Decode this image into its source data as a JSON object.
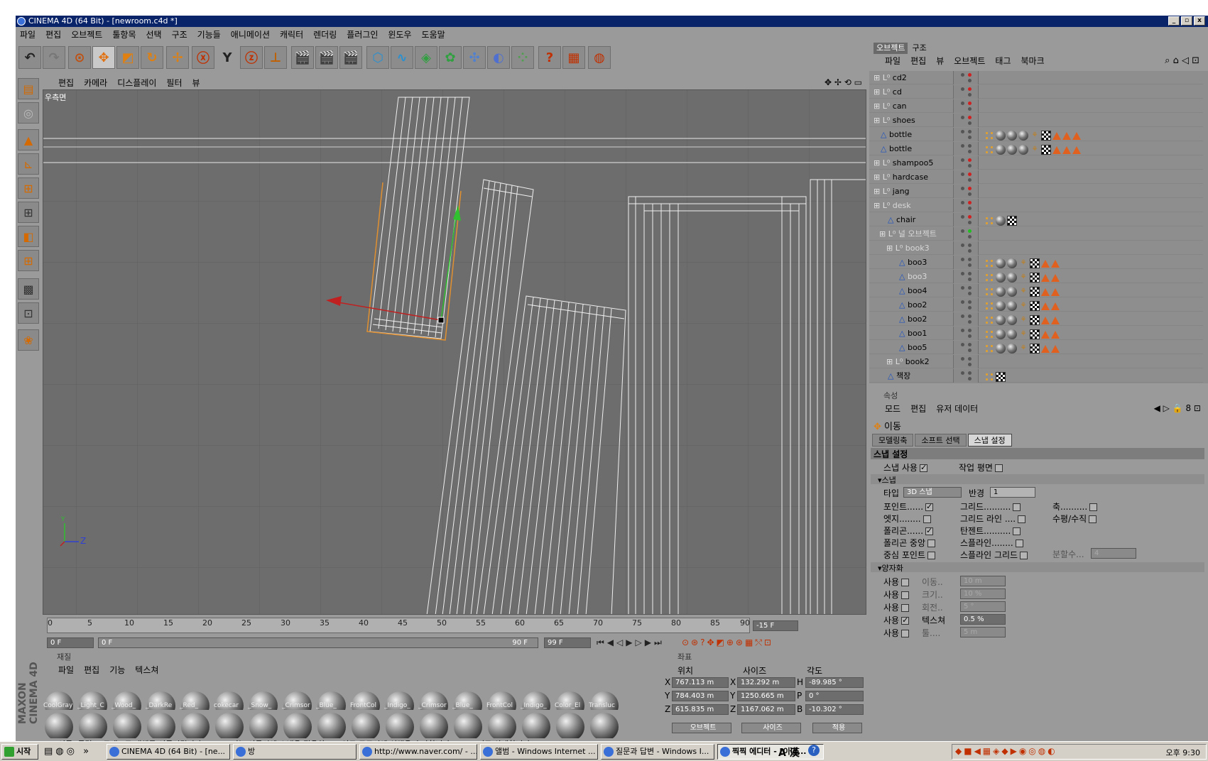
{
  "window": {
    "title": "CINEMA 4D (64 Bit) - [newroom.c4d *]"
  },
  "menu": [
    "파일",
    "편집",
    "오브젝트",
    "툴항목",
    "선택",
    "구조",
    "기능들",
    "애니메이션",
    "캐릭터",
    "렌더링",
    "플러그인",
    "윈도우",
    "도움말"
  ],
  "toolbar": {
    "y_label": "Y",
    "x_label": "X",
    "z_label": "Z"
  },
  "viewport": {
    "menu": [
      "편집",
      "카메라",
      "디스플레이",
      "필터",
      "뷰"
    ],
    "label": "우측면",
    "axis_z": "Z",
    "axis_y": "Y"
  },
  "timeline": {
    "ticks": [
      "0",
      "5",
      "10",
      "15",
      "20",
      "25",
      "30",
      "35",
      "40",
      "45",
      "50",
      "55",
      "60",
      "65",
      "70",
      "75",
      "80",
      "85",
      "90"
    ],
    "end_field": "-15 F",
    "current_frame": "0 F",
    "range_start": "0 F",
    "range_end": "90 F",
    "max_frame": "99 F"
  },
  "materials": {
    "header": "재질",
    "menu": [
      "파일",
      "편집",
      "기능",
      "텍스쳐"
    ],
    "row1": [
      "CoolGray",
      "_Light_C",
      "_Wood_",
      "_DarkRe",
      "_Red_",
      "cokecar",
      "_Snow_",
      "_Crimsor",
      "_Blue_",
      "FrontCol",
      "_Indigo_",
      "_Crimsor",
      "_Blue_",
      "FrontCol",
      "_Indigo_",
      "Color_El",
      "Transluc"
    ],
    "row2_count": 17
  },
  "coords": {
    "header": "좌표",
    "col_position": "위치",
    "col_size": "사이즈",
    "col_angle": "각도",
    "rows": [
      {
        "axis": "X",
        "pos": "767.113 m",
        "size_axis": "X",
        "size": "132.292 m",
        "ang_axis": "H",
        "ang": "-89.985 °"
      },
      {
        "axis": "Y",
        "pos": "784.403 m",
        "size_axis": "Y",
        "size": "1250.665 m",
        "ang_axis": "P",
        "ang": "0 °"
      },
      {
        "axis": "Z",
        "pos": "615.835 m",
        "size_axis": "Z",
        "size": "1167.062 m",
        "ang_axis": "B",
        "ang": "-10.302 °"
      }
    ],
    "mode_select": "오브젝트",
    "size_select": "사이즈",
    "apply_button": "적용"
  },
  "status": "이동: 클릭 & 드래그로 개체를 이동시킵니다. SHIFT 키는 이동시엔 스냅을 적용하고 포인트 모드시엔 선택을 추가합니다. CTRL 키로 삭제합니다.",
  "objects_panel": {
    "tabs": [
      "오브젝트",
      "구조"
    ],
    "menu": [
      "파일",
      "편집",
      "뷰",
      "오브젝트",
      "태그",
      "북마크"
    ],
    "rows": [
      {
        "name": "cd2",
        "tags": ""
      },
      {
        "name": "cd",
        "tags": ""
      },
      {
        "name": "can",
        "tags": ""
      },
      {
        "name": "shoes",
        "tags": ""
      },
      {
        "name": "bottle",
        "tags": "full"
      },
      {
        "name": "bottle",
        "tags": "full"
      },
      {
        "name": "shampoo5",
        "tags": ""
      },
      {
        "name": "hardcase",
        "tags": ""
      },
      {
        "name": "jang",
        "tags": ""
      },
      {
        "name": "desk",
        "tags": ""
      },
      {
        "name": "chair",
        "tags": "short"
      },
      {
        "name": "널 오브젝트",
        "tags": ""
      },
      {
        "name": "book3",
        "tags": ""
      },
      {
        "name": "boo3",
        "tags": "book"
      },
      {
        "name": "boo3",
        "tags": "book"
      },
      {
        "name": "boo4",
        "tags": "book"
      },
      {
        "name": "boo2",
        "tags": "book"
      },
      {
        "name": "boo2",
        "tags": "book"
      },
      {
        "name": "boo1",
        "tags": "book"
      },
      {
        "name": "boo5",
        "tags": "book"
      },
      {
        "name": "book2",
        "tags": ""
      },
      {
        "name": "책장",
        "tags": "mini"
      }
    ]
  },
  "attributes": {
    "header": "속성",
    "menu": [
      "모드",
      "편집",
      "유저 데이터"
    ],
    "tool_name": "이동",
    "tabs": [
      "모델링축",
      "소프트 선택",
      "스냅 설정"
    ],
    "section_title": "스냅 설정",
    "snap_use": "스냅 사용",
    "work_plane": "작업 평면",
    "snap_group": "스냅",
    "type_label": "타입",
    "type_value": "3D 스냅",
    "radius_label": "반경",
    "radius_value": "1",
    "col1": [
      "포인트......",
      "엣지........",
      "폴리곤......",
      "폴리곤 중앙",
      "중심 포인트"
    ],
    "col2": [
      "그리드..........",
      "그리드 라인 ....",
      "탄젠트..........",
      "스플라인........",
      "스플라인 그리드"
    ],
    "col3": [
      "축..........",
      "수평/수직"
    ],
    "subdiv_label": "분할수...",
    "subdiv_value": "4",
    "quant_group": "양자화",
    "quant_rows": [
      {
        "use": "사용",
        "label": "이동..",
        "value": "10 m"
      },
      {
        "use": "사용",
        "label": "크기..",
        "value": "10 %"
      },
      {
        "use": "사용",
        "label": "회전..",
        "value": "5 °"
      },
      {
        "use": "사용",
        "label": "텍스쳐",
        "value": "0.5 %"
      },
      {
        "use": "사용",
        "label": "툴....",
        "value": "5 m"
      }
    ]
  },
  "taskbar": {
    "start": "시작",
    "tasks": [
      "CINEMA 4D (64 Bit) - [ne...",
      "방",
      "http://www.naver.com/ - ...",
      "앨범 - Windows Internet ...",
      "질문과 답변 - Windows I...",
      "찍찍 에디터 - [이미..."
    ],
    "ime": "A 漢",
    "clock": "오후 9:30"
  }
}
